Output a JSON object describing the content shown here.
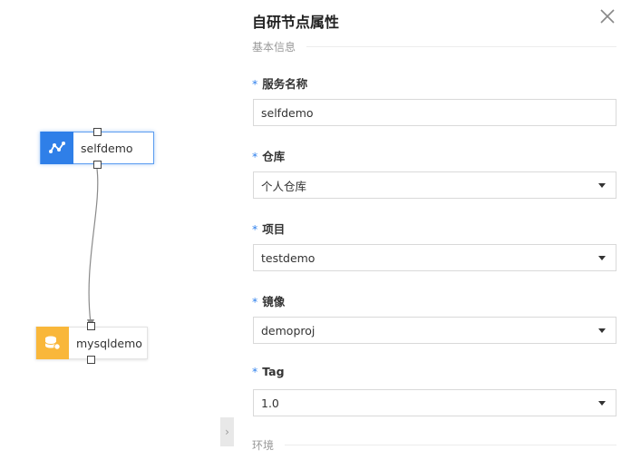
{
  "canvas": {
    "nodes": [
      {
        "id": "selfdemo",
        "label": "selfdemo",
        "icon": "graph-icon",
        "icon_bg": "#2f7fe8",
        "selected": true
      },
      {
        "id": "mysqldemo",
        "label": "mysqldemo",
        "icon": "database-icon",
        "icon_bg": "#f9b73a",
        "selected": false
      }
    ],
    "collapse_icon": "chevron-right-icon"
  },
  "panel": {
    "title": "自研节点属性",
    "close_icon": "close-icon",
    "section_basic": "基本信息",
    "section_env": "环境",
    "required_mark": "*",
    "fields": {
      "service_name": {
        "label": "服务名称",
        "value": "selfdemo"
      },
      "repository": {
        "label": "仓库",
        "value": "个人仓库"
      },
      "project": {
        "label": "项目",
        "value": "testdemo"
      },
      "image": {
        "label": "镜像",
        "value": "demoproj"
      },
      "tag": {
        "label": "Tag",
        "value": "1.0"
      }
    }
  },
  "colors": {
    "accent": "#2f80ed",
    "selfdemo_icon": "#2f7fe8",
    "mysql_icon": "#f9b73a"
  }
}
